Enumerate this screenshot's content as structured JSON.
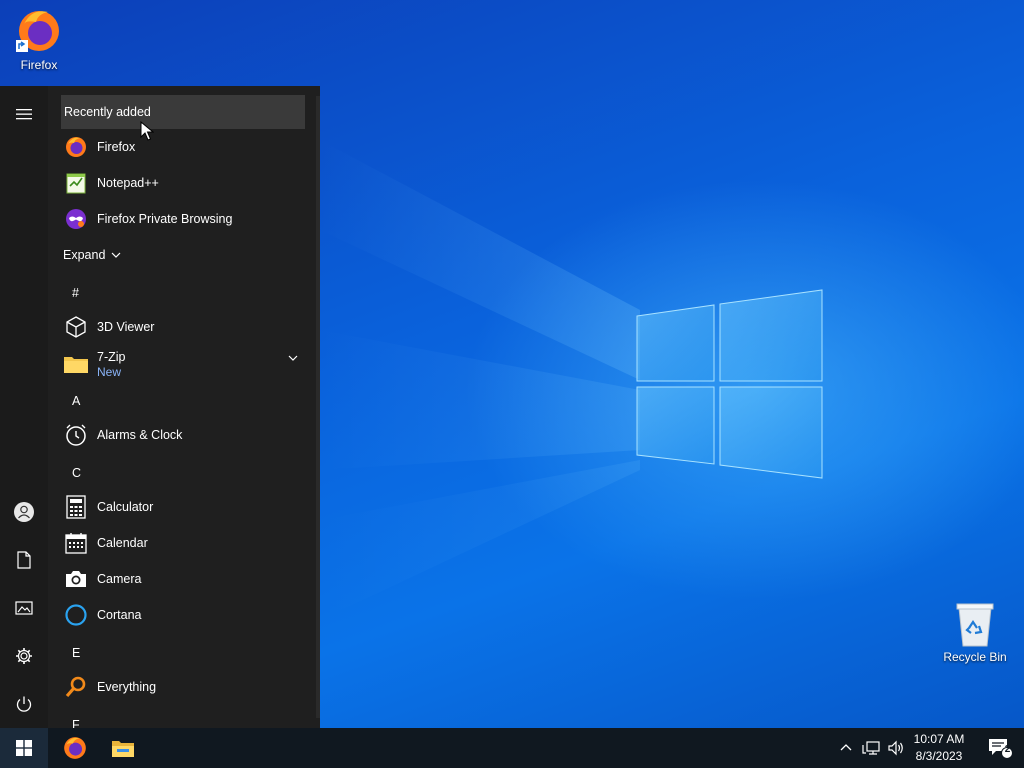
{
  "desktop": {
    "icons": [
      {
        "label": "Firefox",
        "icon": "firefox-icon"
      },
      {
        "label": "Recycle Bin",
        "icon": "recycle-bin-icon"
      }
    ]
  },
  "start_menu": {
    "recently_added_label": "Recently added",
    "recent_apps": [
      {
        "label": "Firefox",
        "icon": "firefox-icon"
      },
      {
        "label": "Notepad++",
        "icon": "notepadpp-icon"
      },
      {
        "label": "Firefox Private Browsing",
        "icon": "firefox-private-icon"
      }
    ],
    "expand_label": "Expand",
    "groups": [
      {
        "letter": "#",
        "apps": [
          {
            "label": "3D Viewer",
            "icon": "cube-icon"
          },
          {
            "label": "7-Zip",
            "sublabel": "New",
            "icon": "folder-icon",
            "has_chevron": true
          }
        ]
      },
      {
        "letter": "A",
        "apps": [
          {
            "label": "Alarms & Clock",
            "icon": "clock-icon"
          }
        ]
      },
      {
        "letter": "C",
        "apps": [
          {
            "label": "Calculator",
            "icon": "calculator-icon"
          },
          {
            "label": "Calendar",
            "icon": "calendar-icon"
          },
          {
            "label": "Camera",
            "icon": "camera-icon"
          },
          {
            "label": "Cortana",
            "icon": "cortana-icon"
          }
        ]
      },
      {
        "letter": "E",
        "apps": [
          {
            "label": "Everything",
            "icon": "search-magnifier-icon"
          }
        ]
      },
      {
        "letter": "F",
        "apps": []
      }
    ],
    "rail": [
      "hamburger-menu-icon",
      "user-icon",
      "documents-icon",
      "pictures-icon",
      "settings-gear-icon",
      "power-icon"
    ]
  },
  "taskbar": {
    "pinned": [
      "windows-start-icon",
      "firefox-icon",
      "file-explorer-icon"
    ],
    "tray": [
      "chevron-up-icon",
      "network-icon",
      "volume-icon"
    ],
    "time": "10:07 AM",
    "date": "8/3/2023",
    "notification_count": "2"
  },
  "colors": {
    "menu_bg": "#1f1f1f",
    "taskbar_bg": "#101820",
    "accent_new": "#8ab4f8",
    "wallpaper": "#0a62dc"
  }
}
